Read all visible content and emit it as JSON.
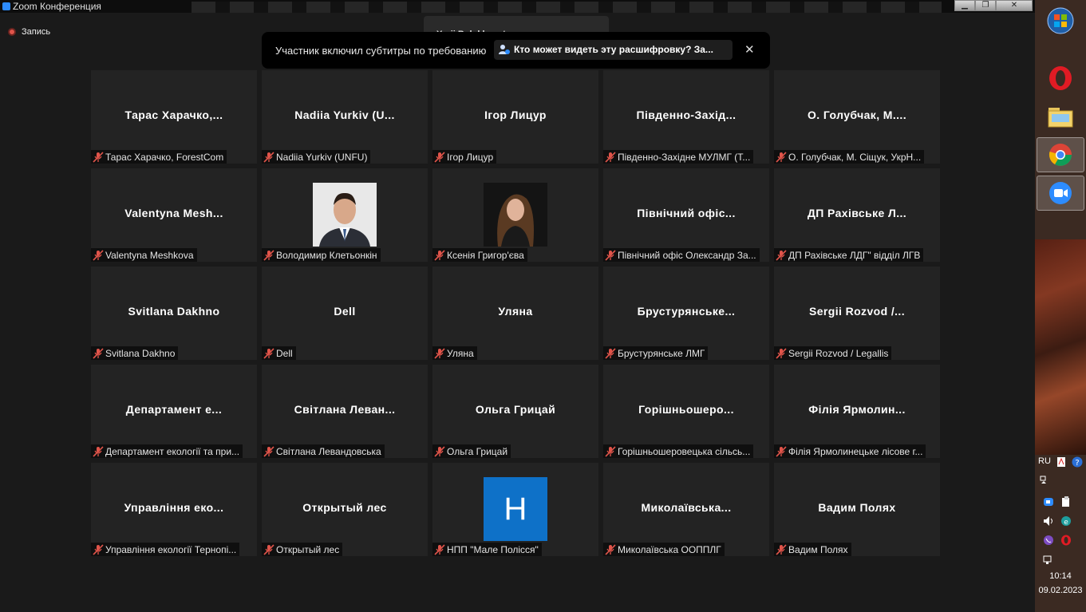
{
  "window": {
    "title": "Zoom Конференция"
  },
  "recording": {
    "label": "Запись"
  },
  "speaking": {
    "text": "Yurii Bolokhovets разговаривает..."
  },
  "caption": {
    "text": "Участник включил субтитры по требованию",
    "link": "Кто может видеть эту расшифровку? За...",
    "close": "✕"
  },
  "tiles": [
    {
      "name": "Тарас  Харачко,...",
      "label": "Тарас Харачко, ForestCom",
      "avatar": "none"
    },
    {
      "name": "Nadiia  Yurkiv  (U...",
      "label": "Nadiia Yurkiv (UNFU)",
      "avatar": "none"
    },
    {
      "name": "Ігор Лицур",
      "label": "Ігор Лицур",
      "avatar": "none"
    },
    {
      "name": "Південно-Захід...",
      "label": "Південно-Західне МУЛМГ (Т...",
      "avatar": "none"
    },
    {
      "name": "О.  Голубчак,  М....",
      "label": "О. Голубчак, М. Сіщук, УкрН...",
      "avatar": "none"
    },
    {
      "name": "Valentyna  Mesh...",
      "label": "Valentyna Meshkova",
      "avatar": "none"
    },
    {
      "name": "",
      "label": "Володимир Клетьонкін",
      "avatar": "photo-man"
    },
    {
      "name": "",
      "label": "Ксенія Григор'єва",
      "avatar": "photo-woman"
    },
    {
      "name": "Північний  офіс...",
      "label": "Північний офіс Олександр За...",
      "avatar": "none"
    },
    {
      "name": "ДП  Рахівське  Л...",
      "label": "ДП Рахівське ЛДГ\" відділ ЛГВ",
      "avatar": "none"
    },
    {
      "name": "Svitlana Dakhno",
      "label": "Svitlana Dakhno",
      "avatar": "none"
    },
    {
      "name": "Dell",
      "label": "Dell",
      "avatar": "none"
    },
    {
      "name": "Уляна",
      "label": "Уляна",
      "avatar": "none"
    },
    {
      "name": "Брустурянське...",
      "label": "Брустурянське ЛМГ",
      "avatar": "none"
    },
    {
      "name": "Sergii  Rozvod  /...",
      "label": "Sergii Rozvod / Legallis",
      "avatar": "none"
    },
    {
      "name": "Департамент  е...",
      "label": "Департамент екології та при...",
      "avatar": "none"
    },
    {
      "name": "Світлана  Леван...",
      "label": "Світлана Левандовська",
      "avatar": "none"
    },
    {
      "name": "Ольга Грицай",
      "label": "Ольга Грицай",
      "avatar": "none"
    },
    {
      "name": "Горішньошеро...",
      "label": "Горішньошеровецька сільсь...",
      "avatar": "none"
    },
    {
      "name": "Філія  Ярмолин...",
      "label": "Філія Ярмолинецьке лісове г...",
      "avatar": "none"
    },
    {
      "name": "Управління  еко...",
      "label": "Управління екології Тернопі...",
      "avatar": "none"
    },
    {
      "name": "Открытый лес",
      "label": "Открытый лес",
      "avatar": "none"
    },
    {
      "name": "",
      "label": "НПП \"Мале Полісся\"",
      "avatar": "letter",
      "letter": "H"
    },
    {
      "name": "Миколаївська...",
      "label": "Миколаївська ООППЛГ",
      "avatar": "none"
    },
    {
      "name": "Вадим Полях",
      "label": "Вадим Полях",
      "avatar": "none"
    }
  ],
  "taskbar": {
    "language": "RU",
    "time": "10:14",
    "date": "09.02.2023"
  },
  "colors": {
    "accent": "#2d8cff",
    "muted_mic": "#e0544a",
    "tile_bg": "#232323"
  }
}
